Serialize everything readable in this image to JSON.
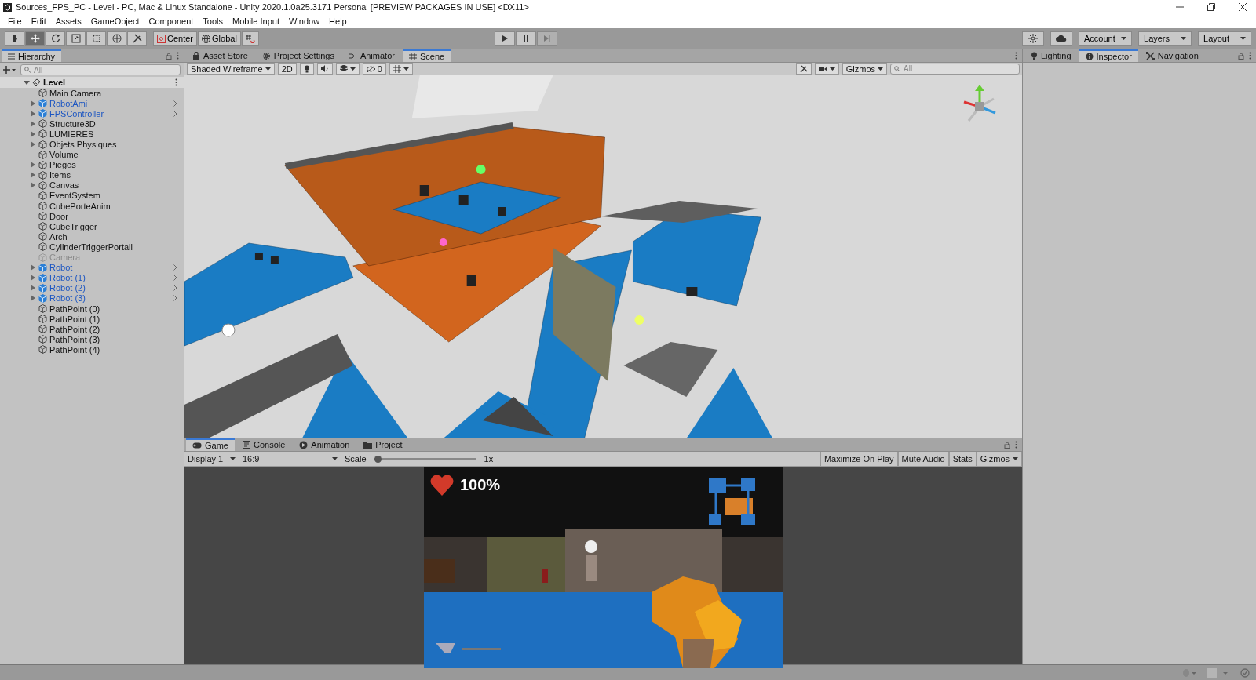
{
  "window": {
    "title": "Sources_FPS_PC - Level - PC, Mac & Linux Standalone - Unity 2020.1.0a25.3171 Personal [PREVIEW PACKAGES IN USE] <DX11>"
  },
  "menu": [
    "File",
    "Edit",
    "Assets",
    "GameObject",
    "Component",
    "Tools",
    "Mobile Input",
    "Window",
    "Help"
  ],
  "toolbar": {
    "tools": [
      {
        "kind": "hand",
        "selected": false
      },
      {
        "kind": "move",
        "selected": true
      },
      {
        "kind": "rotate",
        "selected": false
      },
      {
        "kind": "scale",
        "selected": false
      },
      {
        "kind": "rect",
        "selected": false
      },
      {
        "kind": "transform",
        "selected": false
      },
      {
        "kind": "custom",
        "selected": false
      }
    ],
    "pivot": [
      {
        "kind": "center",
        "label": "Center"
      },
      {
        "kind": "global",
        "label": "Global"
      },
      {
        "kind": "snap"
      }
    ],
    "play": [
      {
        "kind": "play",
        "disabled": false
      },
      {
        "kind": "pause",
        "disabled": false
      },
      {
        "kind": "step",
        "disabled": true
      }
    ],
    "right": [
      {
        "kind": "collab"
      },
      {
        "kind": "cloud"
      },
      {
        "kind": "dropdown",
        "label": "Account"
      },
      {
        "kind": "dropdown",
        "label": "Layers"
      },
      {
        "kind": "dropdown",
        "label": "Layout"
      }
    ]
  },
  "hierarchy": {
    "tab": "Hierarchy",
    "search_placeholder": "All",
    "root": {
      "name": "Level",
      "expanded": true,
      "children": [
        {
          "name": "Main Camera",
          "kind": "object",
          "expandable": false
        },
        {
          "name": "RobotAmi",
          "kind": "prefab",
          "expandable": true
        },
        {
          "name": "FPSController",
          "kind": "prefab",
          "expandable": true
        },
        {
          "name": "Structure3D",
          "kind": "object",
          "expandable": true
        },
        {
          "name": "LUMIERES",
          "kind": "object",
          "expandable": true
        },
        {
          "name": "Objets Physiques",
          "kind": "object",
          "expandable": true
        },
        {
          "name": "Volume",
          "kind": "object",
          "expandable": false
        },
        {
          "name": "Pieges",
          "kind": "object",
          "expandable": true
        },
        {
          "name": "Items",
          "kind": "object",
          "expandable": true
        },
        {
          "name": "Canvas",
          "kind": "object",
          "expandable": true
        },
        {
          "name": "EventSystem",
          "kind": "object",
          "expandable": false
        },
        {
          "name": "CubePorteAnim",
          "kind": "object",
          "expandable": false
        },
        {
          "name": "Door",
          "kind": "object",
          "expandable": false
        },
        {
          "name": "CubeTrigger",
          "kind": "object",
          "expandable": false
        },
        {
          "name": "Arch",
          "kind": "object",
          "expandable": false
        },
        {
          "name": "CylinderTriggerPortail",
          "kind": "object",
          "expandable": false
        },
        {
          "name": "Camera",
          "kind": "inactive",
          "expandable": false
        },
        {
          "name": "Robot",
          "kind": "prefab",
          "expandable": true
        },
        {
          "name": "Robot (1)",
          "kind": "prefab",
          "expandable": true
        },
        {
          "name": "Robot (2)",
          "kind": "prefab",
          "expandable": true
        },
        {
          "name": "Robot (3)",
          "kind": "prefab",
          "expandable": true
        },
        {
          "name": "PathPoint (0)",
          "kind": "object",
          "expandable": false
        },
        {
          "name": "PathPoint (1)",
          "kind": "object",
          "expandable": false
        },
        {
          "name": "PathPoint (2)",
          "kind": "object",
          "expandable": false
        },
        {
          "name": "PathPoint (3)",
          "kind": "object",
          "expandable": false
        },
        {
          "name": "PathPoint (4)",
          "kind": "object",
          "expandable": false
        }
      ]
    }
  },
  "center_tabs": [
    {
      "kind": "lock",
      "label": "Asset Store",
      "selected": false
    },
    {
      "kind": "gear",
      "label": "Project Settings",
      "selected": false
    },
    {
      "kind": "animator",
      "label": "Animator",
      "selected": false
    },
    {
      "kind": "grid",
      "label": "Scene",
      "selected": true
    }
  ],
  "scene_toolbar": {
    "draw_mode": "Shaded Wireframe",
    "mode_2d": "2D",
    "hidden_count": "0",
    "gizmos": "Gizmos",
    "search_placeholder": "All"
  },
  "game_tabs": [
    {
      "kind": "gamepad",
      "label": "Game",
      "selected": true
    },
    {
      "kind": "console",
      "label": "Console",
      "selected": false
    },
    {
      "kind": "animation",
      "label": "Animation",
      "selected": false
    },
    {
      "kind": "folder",
      "label": "Project",
      "selected": false
    }
  ],
  "game_toolbar": {
    "display": "Display 1",
    "aspect": "16:9",
    "scale_label": "Scale",
    "scale": {
      "level": 0.0,
      "reading": "1x"
    },
    "buttons": [
      "Maximize On Play",
      "Mute Audio",
      "Stats",
      "Gizmos"
    ]
  },
  "game_hud": {
    "health": "100%"
  },
  "right_tabs": [
    {
      "kind": "bulb",
      "label": "Lighting",
      "selected": false
    },
    {
      "kind": "info",
      "label": "Inspector",
      "selected": true
    },
    {
      "kind": "nav",
      "label": "Navigation",
      "selected": false
    }
  ]
}
